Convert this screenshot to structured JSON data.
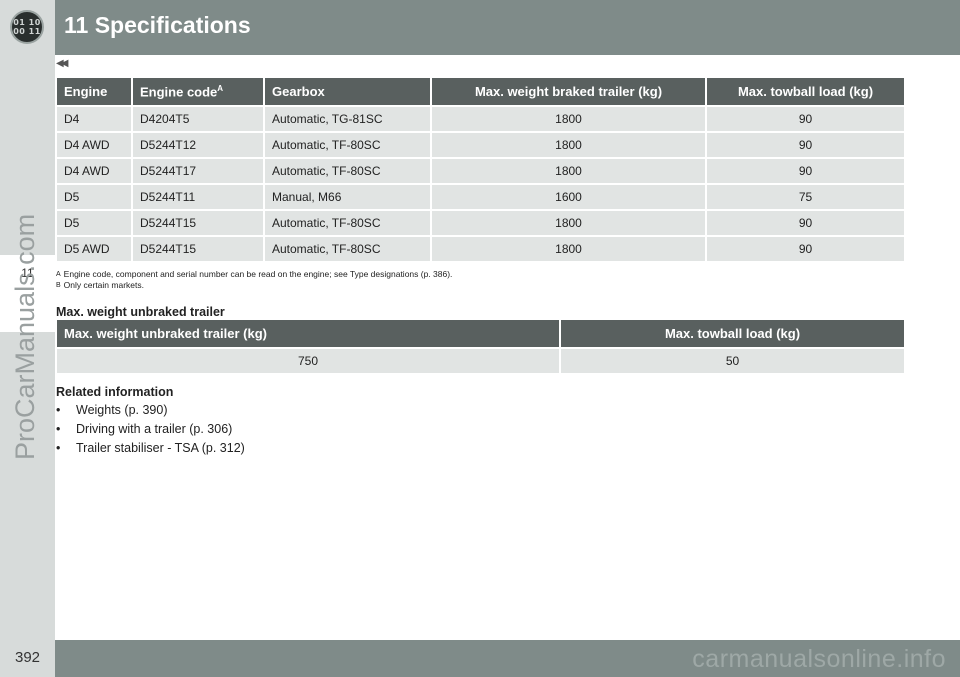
{
  "header": {
    "chapter_title": "11 Specifications",
    "logo_line1": "01 10",
    "logo_line2": "00 11"
  },
  "sidebar": {
    "chapter_number": "11",
    "watermark": "ProCarManuals.com"
  },
  "continued_marker": "◀◀",
  "specs_table": {
    "headers": [
      "Engine",
      "Engine code",
      "Gearbox",
      "Max. weight braked trailer (kg)",
      "Max. towball load (kg)"
    ],
    "engine_code_superscript": "A",
    "rows": [
      [
        "D4",
        "D4204T5",
        "Automatic, TG-81SC",
        "1800",
        "90"
      ],
      [
        "D4 AWD",
        "D5244T12",
        "Automatic, TF-80SC",
        "1800",
        "90"
      ],
      [
        "D4 AWD",
        "D5244T17",
        "Automatic, TF-80SC",
        "1800",
        "90"
      ],
      [
        "D5",
        "D5244T11",
        "Manual, M66",
        "1600",
        "75"
      ],
      [
        "D5",
        "D5244T15",
        "Automatic, TF-80SC",
        "1800",
        "90"
      ],
      [
        "D5 AWD",
        "D5244T15",
        "Automatic, TF-80SC",
        "1800",
        "90"
      ]
    ]
  },
  "footnotes": [
    {
      "key": "A",
      "text": "Engine code, component and serial number can be read on the engine; see Type designations (p. 386)."
    },
    {
      "key": "B",
      "text": "Only certain markets."
    }
  ],
  "unbraked_section": {
    "heading": "Max. weight unbraked trailer",
    "headers": [
      "Max. weight unbraked trailer (kg)",
      "Max. towball load (kg)"
    ],
    "values": [
      "750",
      "50"
    ]
  },
  "related": {
    "heading": "Related information",
    "items": [
      "Weights (p. 390)",
      "Driving with a trailer (p. 306)",
      "Trailer stabiliser - TSA (p. 312)"
    ]
  },
  "footer": {
    "page_number": "392",
    "watermark": "carmanualsonline.info"
  },
  "colors": {
    "header_bar": "#7f8b89",
    "table_header": "#59605f",
    "table_cell": "#e1e4e3",
    "side_strip": "#d7dbda"
  }
}
